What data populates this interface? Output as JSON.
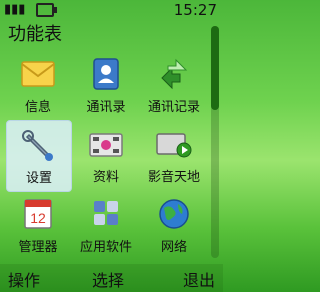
{
  "status": {
    "time": "15:27"
  },
  "title": "功能表",
  "menu": [
    {
      "label": "信息",
      "icon": "envelope-icon"
    },
    {
      "label": "通讯录",
      "icon": "contacts-book-icon"
    },
    {
      "label": "通讯记录",
      "icon": "call-log-arrows-icon"
    },
    {
      "label": "设置",
      "icon": "wrench-icon",
      "selected": true
    },
    {
      "label": "资料",
      "icon": "media-folder-icon"
    },
    {
      "label": "影音天地",
      "icon": "video-player-icon"
    },
    {
      "label": "管理器",
      "icon": "calendar-icon"
    },
    {
      "label": "应用软件",
      "icon": "apps-grid-icon"
    },
    {
      "label": "网络",
      "icon": "globe-icon"
    }
  ],
  "softkeys": {
    "left": "操作",
    "middle": "选择",
    "right": "退出"
  },
  "colors": {
    "background": "#6fd24f",
    "selection": "#dcf0fa",
    "scrollbar": "#1d6b12"
  }
}
